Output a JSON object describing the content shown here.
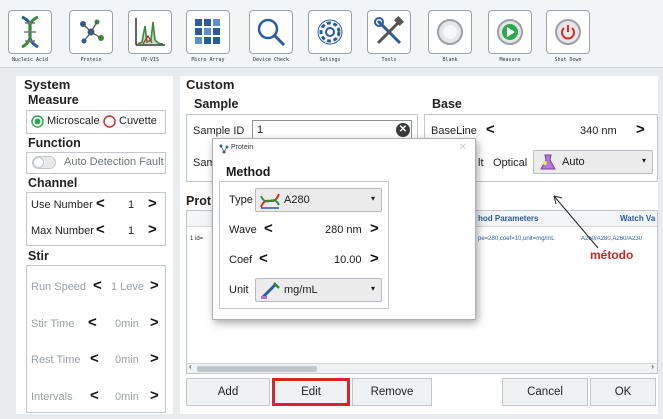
{
  "toolbar": {
    "buttons": [
      {
        "label": "Nucleic Acid",
        "icon": "dna-icon"
      },
      {
        "label": "Protein",
        "icon": "protein-icon"
      },
      {
        "label": "UV-VIS",
        "icon": "spectrum-icon"
      },
      {
        "label": "Micro Array",
        "icon": "micro-array-icon"
      },
      {
        "label": "Device Check",
        "icon": "magnifier-icon"
      },
      {
        "label": "Setings",
        "icon": "gear-icon"
      },
      {
        "label": "Tools",
        "icon": "tools-icon"
      },
      {
        "label": "Blank",
        "icon": "blank-icon"
      },
      {
        "label": "Measure",
        "icon": "play-icon"
      },
      {
        "label": "Shut Down",
        "icon": "power-icon"
      }
    ]
  },
  "system": {
    "title": "System",
    "measure": {
      "title": "Measure",
      "microscale": "Microscale",
      "cuvette": "Cuvette"
    },
    "function": {
      "title": "Function",
      "auto_detection": "Auto Detection Fault"
    },
    "channel": {
      "title": "Channel",
      "use_number_label": "Use Number",
      "use_number_value": "1",
      "max_number_label": "Max Number",
      "max_number_value": "1"
    },
    "stir": {
      "title": "Stir",
      "run_speed_label": "Run Speed",
      "run_speed_value": "1 Leve",
      "stir_time_label": "Stir Time",
      "stir_time_value": "0min",
      "rest_time_label": "Rest Time",
      "rest_time_value": "0min",
      "intervals_label": "Intervals",
      "intervals_value": "0min"
    }
  },
  "custom": {
    "title": "Custom",
    "sample": {
      "title": "Sample",
      "sample_id_label": "Sample ID",
      "sample_id_value": "1",
      "sample_name_label_partial": "Sam"
    },
    "base": {
      "title": "Base",
      "baseline_label": "BaseLine",
      "baseline_value": "340 nm",
      "default_partial": "lt",
      "optical_label": "Optical",
      "optical_value": "Auto"
    },
    "protein_table": {
      "title_partial": "Prot",
      "row_id_partial": "1  id=",
      "col_method_params": "hod Parameters",
      "col_watch": "Watch Va",
      "row_method_params": "pe=280,coef=10,unit=mg/mL",
      "row_watch": "A260/A280,A260/A230"
    },
    "annotation": "método",
    "buttons": {
      "add": "Add",
      "edit": "Edit",
      "remove": "Remove",
      "cancel": "Cancel",
      "ok": "OK"
    }
  },
  "dialog": {
    "window_title": "Protein",
    "title": "Method",
    "type_label": "Type",
    "type_value": "A280",
    "wave_label": "Wave",
    "wave_value": "280 nm",
    "coef_label": "Coef",
    "coef_value": "10.00",
    "unit_label": "Unit",
    "unit_value": "mg/mL"
  },
  "colors": {
    "accent_green": "#2fa84f",
    "radio_red": "#d0312d",
    "highlight_red": "#d9242b",
    "annotation_red": "#c62828"
  }
}
